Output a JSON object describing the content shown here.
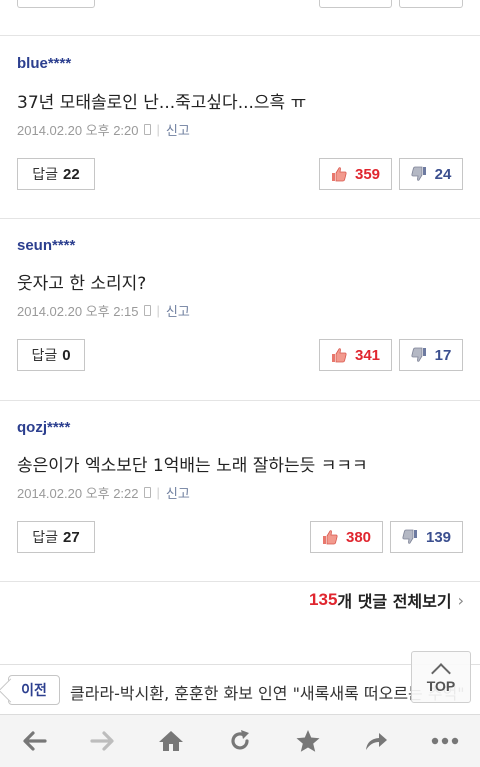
{
  "comments": [
    {
      "user": "blue****",
      "text": "37년 모태솔로인 난...죽고싶다...으흑 ㅠ",
      "date": "2014.02.20 오후 2:20",
      "report": "신고",
      "reply_label": "답글",
      "reply_count": "22",
      "likes": "359",
      "dislikes": "24"
    },
    {
      "user": "seun****",
      "text": "웃자고 한 소리지?",
      "date": "2014.02.20 오후 2:15",
      "report": "신고",
      "reply_label": "답글",
      "reply_count": "0",
      "likes": "341",
      "dislikes": "17"
    },
    {
      "user": "qozj****",
      "text": "송은이가 엑소보단 1억배는 노래 잘하는듯 ㅋㅋㅋ",
      "date": "2014.02.20 오후 2:22",
      "report": "신고",
      "reply_label": "답글",
      "reply_count": "27",
      "likes": "380",
      "dislikes": "139"
    }
  ],
  "view_all": {
    "count": "135",
    "label": "개 댓글 전체보기"
  },
  "prev_article": {
    "button_label": "이전",
    "title": "클라라-박시환, 훈훈한 화보 인연 \"새록새록 떠오르는 추억\""
  },
  "top_button": {
    "label": "TOP"
  },
  "browser_nav": [
    "back-icon",
    "forward-icon",
    "home-icon",
    "refresh-icon",
    "bookmark-icon",
    "share-icon",
    "more-icon"
  ],
  "colors": {
    "accent_red": "#e0262f",
    "accent_navy": "#2c3f8f"
  }
}
